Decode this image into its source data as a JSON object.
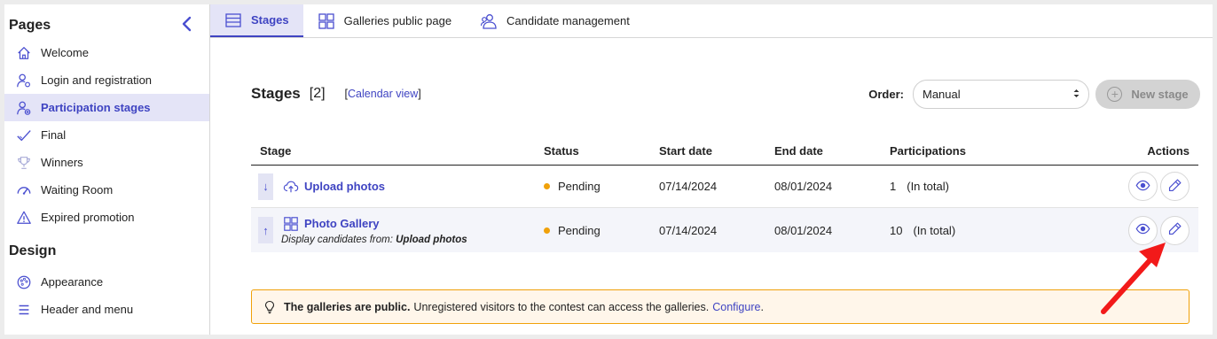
{
  "sidebar": {
    "title": "Pages",
    "collapse_icon": "chevron-left-icon",
    "items": [
      {
        "label": "Welcome",
        "icon": "home-icon"
      },
      {
        "label": "Login and registration",
        "icon": "user-settings-icon"
      },
      {
        "label": "Participation stages",
        "icon": "user-add-icon",
        "active": true
      },
      {
        "label": "Final",
        "icon": "check-icon"
      },
      {
        "label": "Winners",
        "icon": "trophy-icon"
      },
      {
        "label": "Waiting Room",
        "icon": "gauge-icon"
      },
      {
        "label": "Expired promotion",
        "icon": "warning-icon"
      }
    ],
    "design_title": "Design",
    "design_items": [
      {
        "label": "Appearance",
        "icon": "palette-icon"
      },
      {
        "label": "Header and menu",
        "icon": "menu-icon"
      }
    ]
  },
  "tabs": [
    {
      "label": "Stages",
      "icon": "list-icon",
      "active": true
    },
    {
      "label": "Galleries public page",
      "icon": "grid-icon"
    },
    {
      "label": "Candidate management",
      "icon": "users-icon"
    }
  ],
  "stages": {
    "title": "Stages",
    "count": "[2]",
    "calendar_open": "[",
    "calendar_link": "Calendar view",
    "calendar_close": "]",
    "order_label": "Order:",
    "order_value": "Manual",
    "new_stage_label": "New stage"
  },
  "table": {
    "headers": [
      "Stage",
      "Status",
      "Start date",
      "End date",
      "Participations",
      "Actions"
    ],
    "rows": [
      {
        "move": "↓",
        "icon": "cloud-upload-icon",
        "name": "Upload photos",
        "status": "Pending",
        "start": "07/14/2024",
        "end": "08/01/2024",
        "participations": "1",
        "participations_note": "(In total)"
      },
      {
        "move": "↑",
        "icon": "grid-icon",
        "name": "Photo Gallery",
        "sub_prefix": "Display candidates from:",
        "sub_source": "Upload photos",
        "status": "Pending",
        "start": "07/14/2024",
        "end": "08/01/2024",
        "participations": "10",
        "participations_note": "(In total)"
      }
    ]
  },
  "notice": {
    "bold": "The galleries are public.",
    "text": "Unregistered visitors to the contest can access the galleries.",
    "link": "Configure",
    "end": "."
  },
  "colors": {
    "accent": "#3f44c2",
    "active_bg": "#e4e4f7",
    "pending": "#f0a10a",
    "annotation_arrow": "#f21a1a"
  }
}
